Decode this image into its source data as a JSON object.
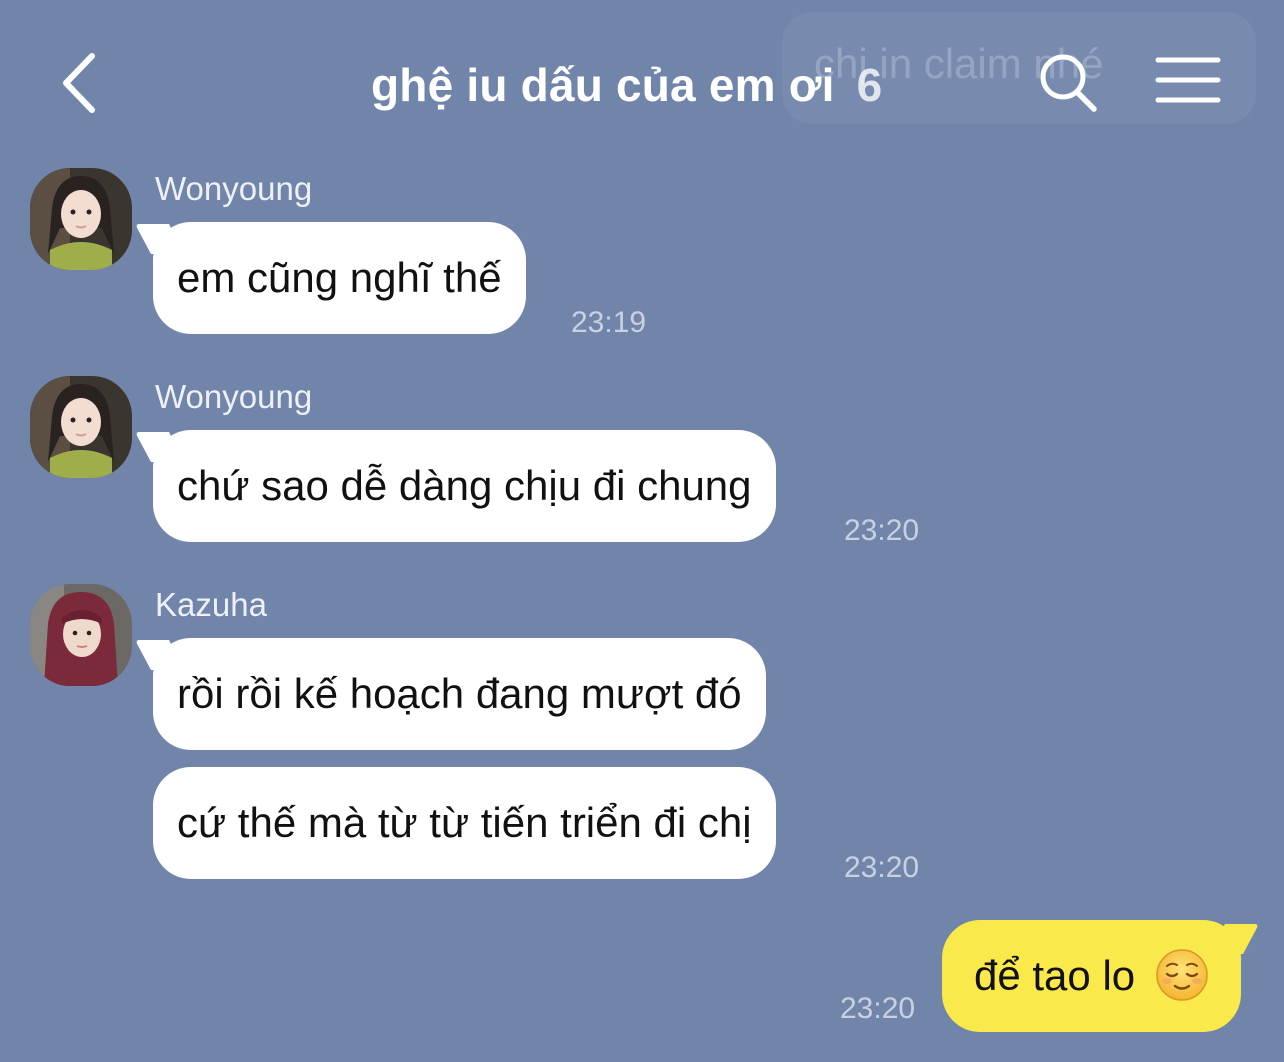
{
  "header": {
    "title": "ghệ iu dấu của em ơi",
    "member_count": "6",
    "back_icon": "chevron-left-icon",
    "search_icon": "search-icon",
    "menu_icon": "hamburger-menu-icon",
    "ghost_banner_text": "chị in claim nhé"
  },
  "messages": [
    {
      "sender": "Wonyoung",
      "text": "em cũng nghĩ thế",
      "time": "23:19",
      "avatar": "avatar-wonyoung"
    },
    {
      "sender": "Wonyoung",
      "text": "chứ sao dễ dàng chịu đi chung",
      "time": "23:20",
      "avatar": "avatar-wonyoung"
    },
    {
      "sender": "Kazuha",
      "text": "rồi rồi kế hoạch đang mượt đó",
      "time": "",
      "avatar": "avatar-kazuha"
    },
    {
      "sender": "",
      "text": "cứ thế mà từ từ tiến triển đi chị",
      "time": "23:20",
      "avatar": ""
    },
    {
      "sender": "me",
      "text": "để tao lo",
      "time": "23:20",
      "emoji": "relieved-face-emoji"
    }
  ],
  "colors": {
    "background": "#7185ab",
    "incoming_bubble": "#ffffff",
    "outgoing_bubble": "#f9e94a"
  }
}
